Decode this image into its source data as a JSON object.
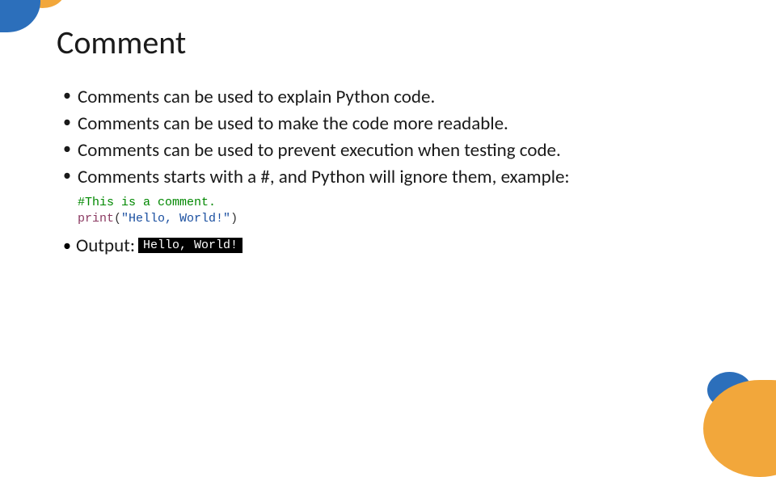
{
  "title": "Comment",
  "bullets": [
    "Comments can be used to explain Python code.",
    "Comments can be used to make the code more readable.",
    "Comments can be used to prevent execution when testing code.",
    "Comments starts with a #, and Python will ignore them, example:"
  ],
  "code": {
    "comment": "#This is a comment.",
    "func": "print",
    "paren_open": "(",
    "string": "\"Hello, World!\"",
    "paren_close": ")"
  },
  "output": {
    "label": "Output:",
    "value": "Hello, World!"
  }
}
